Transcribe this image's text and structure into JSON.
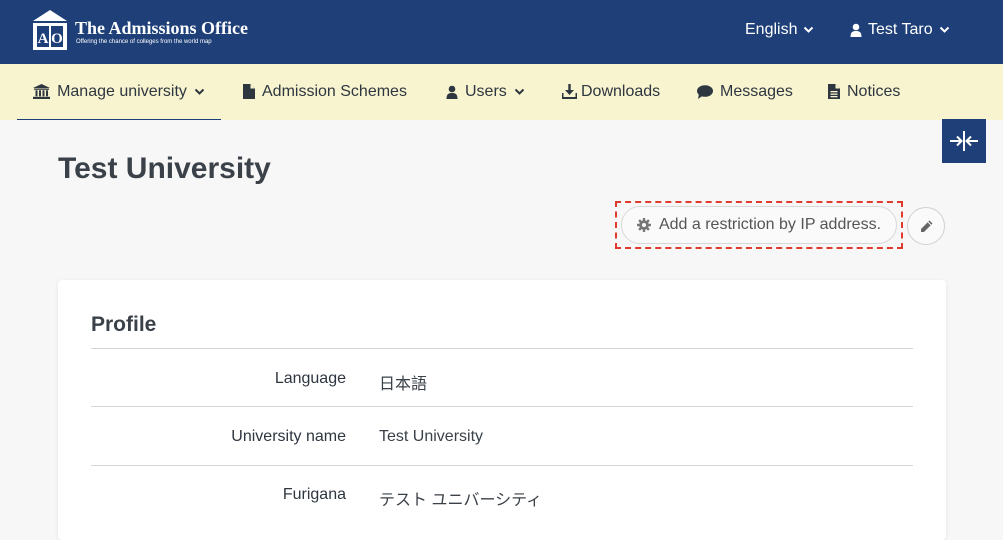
{
  "header": {
    "brand_title": "The Admissions Office",
    "brand_subtitle": "Offering the chance of colleges from the world map",
    "logo_letters": "AO",
    "language": "English",
    "user": "Test Taro"
  },
  "nav": {
    "items": [
      {
        "label": "Manage university",
        "icon": "university-icon",
        "dropdown": true,
        "active": true
      },
      {
        "label": "Admission Schemes",
        "icon": "file-icon"
      },
      {
        "label": "Users",
        "icon": "user-icon",
        "dropdown": true
      },
      {
        "label": "Downloads",
        "icon": "download-icon"
      },
      {
        "label": "Messages",
        "icon": "comment-icon"
      },
      {
        "label": "Notices",
        "icon": "document-icon"
      }
    ]
  },
  "page": {
    "title": "Test University",
    "ip_restriction_label": "Add a restriction by IP address."
  },
  "profile": {
    "title": "Profile",
    "rows": [
      {
        "label": "Language",
        "value": "日本語"
      },
      {
        "label": "University name",
        "value": "Test University"
      },
      {
        "label": "Furigana",
        "value": "テスト ユニバーシティ"
      }
    ]
  },
  "colors": {
    "header_bg": "#1e3f78",
    "nav_bg": "#f8f4cf",
    "highlight": "#e03a2f"
  }
}
